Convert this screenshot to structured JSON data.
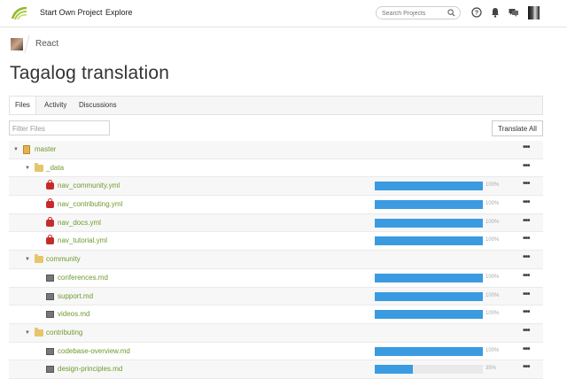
{
  "nav": {
    "start_own_project": "Start Own Project",
    "explore": "Explore",
    "search_placeholder": "Search Projects"
  },
  "breadcrumb": {
    "project": "React"
  },
  "page_title": "Tagalog translation",
  "tabs": [
    "Files",
    "Activity",
    "Discussions"
  ],
  "active_tab": "Files",
  "filter_placeholder": "Filter Files",
  "translate_all": "Translate All",
  "colors": {
    "accent_green": "#6f9a2f",
    "progress_blue": "#3b9be0",
    "folder_yellow": "#e7c56a",
    "lock_red": "#c62b2b"
  },
  "tree": [
    {
      "type": "repo",
      "name": "master",
      "level": 0,
      "icon": "repo-icon"
    },
    {
      "type": "folder",
      "name": "_data",
      "level": 1,
      "icon": "folder-icon"
    },
    {
      "type": "file",
      "name": "nav_community.yml",
      "level": 2,
      "icon": "lock-icon",
      "progress": 100,
      "pct": "100%"
    },
    {
      "type": "file",
      "name": "nav_contributing.yml",
      "level": 2,
      "icon": "lock-icon",
      "progress": 100,
      "pct": "100%"
    },
    {
      "type": "file",
      "name": "nav_docs.yml",
      "level": 2,
      "icon": "lock-icon",
      "progress": 100,
      "pct": "100%"
    },
    {
      "type": "file",
      "name": "nav_tutorial.yml",
      "level": 2,
      "icon": "lock-icon",
      "progress": 100,
      "pct": "100%"
    },
    {
      "type": "folder",
      "name": "community",
      "level": 1,
      "icon": "folder-icon"
    },
    {
      "type": "file",
      "name": "conferences.md",
      "level": 2,
      "icon": "document-icon",
      "progress": 100,
      "pct": "100%"
    },
    {
      "type": "file",
      "name": "support.md",
      "level": 2,
      "icon": "document-icon",
      "progress": 100,
      "pct": "100%"
    },
    {
      "type": "file",
      "name": "videos.md",
      "level": 2,
      "icon": "document-icon",
      "progress": 100,
      "pct": "100%"
    },
    {
      "type": "folder",
      "name": "contributing",
      "level": 1,
      "icon": "folder-icon"
    },
    {
      "type": "file",
      "name": "codebase-overview.md",
      "level": 2,
      "icon": "document-icon",
      "progress": 100,
      "pct": "100%"
    },
    {
      "type": "file",
      "name": "design-principles.md",
      "level": 2,
      "icon": "document-icon",
      "progress": 35,
      "pct": "35%"
    }
  ]
}
